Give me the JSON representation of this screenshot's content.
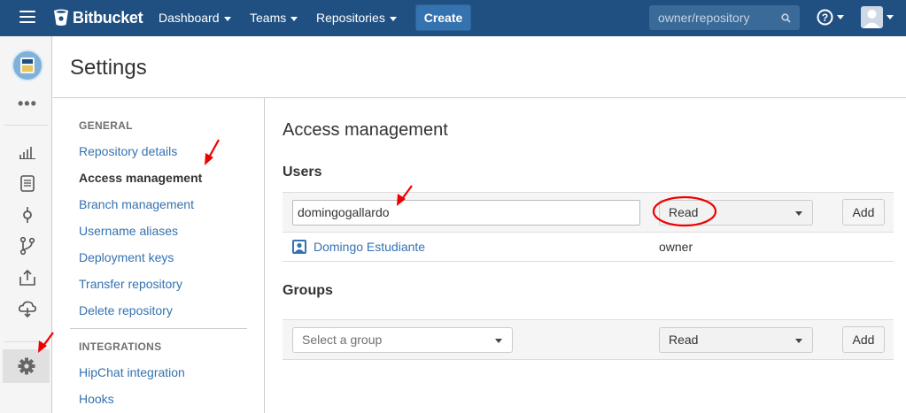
{
  "header": {
    "brand": "Bitbucket",
    "nav": [
      {
        "label": "Dashboard"
      },
      {
        "label": "Teams"
      },
      {
        "label": "Repositories"
      }
    ],
    "create_label": "Create",
    "search_placeholder": "owner/repository",
    "accent_color": "#205081"
  },
  "rail": {
    "icons": [
      "more-icon",
      "overview-icon",
      "source-icon",
      "commits-icon",
      "branches-icon",
      "pull-requests-icon",
      "downloads-icon",
      "settings-icon"
    ]
  },
  "page": {
    "title": "Settings"
  },
  "submenu": {
    "general_title": "GENERAL",
    "general_items": [
      {
        "label": "Repository details"
      },
      {
        "label": "Access management",
        "active": true
      },
      {
        "label": "Branch management"
      },
      {
        "label": "Username aliases"
      },
      {
        "label": "Deployment keys"
      },
      {
        "label": "Transfer repository"
      },
      {
        "label": "Delete repository"
      }
    ],
    "integrations_title": "INTEGRATIONS",
    "integrations_items": [
      {
        "label": "HipChat integration"
      },
      {
        "label": "Hooks"
      }
    ]
  },
  "access": {
    "title": "Access management",
    "users_title": "Users",
    "user_input_value": "domingogallardo",
    "user_permission": "Read",
    "add_label": "Add",
    "users": [
      {
        "name": "Domingo Estudiante",
        "role": "owner"
      }
    ],
    "groups_title": "Groups",
    "group_placeholder": "Select a group",
    "group_permission": "Read",
    "group_add_label": "Add"
  }
}
